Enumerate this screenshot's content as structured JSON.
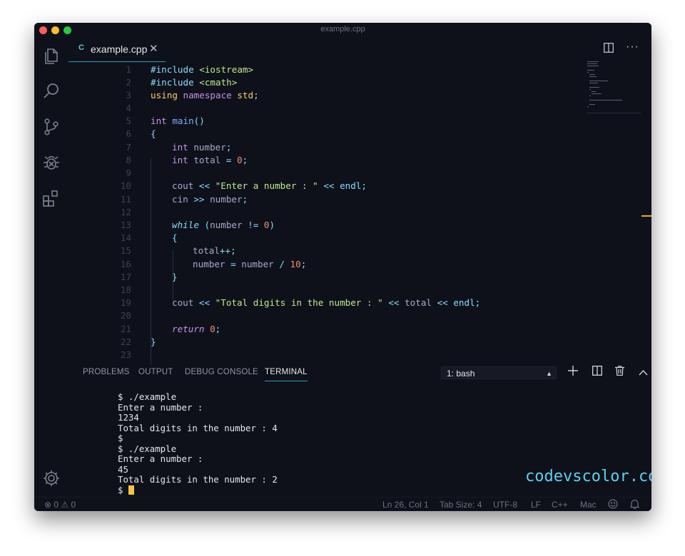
{
  "window": {
    "title": "example.cpp"
  },
  "tab": {
    "icon": "cpp-file-icon",
    "icon_glyph": "C",
    "label": "example.cpp",
    "close": "✕"
  },
  "editor": {
    "lines": [
      {
        "n": "1"
      },
      {
        "n": "2"
      },
      {
        "n": "3"
      },
      {
        "n": "4"
      },
      {
        "n": "5"
      },
      {
        "n": "6"
      },
      {
        "n": "7"
      },
      {
        "n": "8"
      },
      {
        "n": "9"
      },
      {
        "n": "10"
      },
      {
        "n": "11"
      },
      {
        "n": "12"
      },
      {
        "n": "13"
      },
      {
        "n": "14"
      },
      {
        "n": "15"
      },
      {
        "n": "16"
      },
      {
        "n": "17"
      },
      {
        "n": "18"
      },
      {
        "n": "19"
      },
      {
        "n": "20"
      },
      {
        "n": "21"
      },
      {
        "n": "22"
      },
      {
        "n": "23"
      }
    ],
    "code": {
      "l1_a": "#include",
      "l1_b": " <iostream>",
      "l2_a": "#include",
      "l2_b": " <cmath>",
      "l3_a": "using",
      "l3_b": " namespace",
      "l3_c": " std",
      "l3_d": ";",
      "l5_a": "int",
      "l5_b": " main",
      "l5_c": "()",
      "l6": "{",
      "l7_a": "int",
      "l7_b": " number",
      "l7_c": ";",
      "l8_a": "int",
      "l8_b": " total ",
      "l8_c": "=",
      "l8_d": " 0",
      "l8_e": ";",
      "l10_a": "cout ",
      "l10_b": "<<",
      "l10_c": " \"Enter a number : \"",
      "l10_d": " <<",
      "l10_e": " endl",
      "l10_f": ";",
      "l11_a": "cin ",
      "l11_b": ">>",
      "l11_c": " number",
      "l11_d": ";",
      "l13_a": "while",
      "l13_b": " (",
      "l13_c": "number ",
      "l13_d": "!=",
      "l13_e": " 0",
      "l13_f": ")",
      "l14": "{",
      "l15_a": "total",
      "l15_b": "++",
      "l15_c": ";",
      "l16_a": "number ",
      "l16_b": "=",
      "l16_c": " number ",
      "l16_d": "/",
      "l16_e": " 10",
      "l16_f": ";",
      "l17": "}",
      "l19_a": "cout ",
      "l19_b": "<<",
      "l19_c": " \"Total digits in the number : \"",
      "l19_d": " <<",
      "l19_e": " total ",
      "l19_f": "<<",
      "l19_g": " endl",
      "l19_h": ";",
      "l21_a": "return",
      "l21_b": " 0",
      "l21_c": ";",
      "l22": "}"
    }
  },
  "panel": {
    "tabs": [
      "PROBLEMS",
      "OUTPUT",
      "DEBUG CONSOLE",
      "TERMINAL"
    ],
    "active_tab": "TERMINAL",
    "terminal_select": "1: bash",
    "terminal_lines": [
      "$ ./example",
      "Enter a number :",
      "1234",
      "Total digits in the number : 4",
      "$",
      "$ ./example",
      "Enter a number :",
      "45",
      "Total digits in the number : 2",
      "$ "
    ],
    "watermark": "codevscolor.com"
  },
  "statusbar": {
    "errors": "0",
    "warnings": "0",
    "position": "Ln 26, Col 1",
    "tab_size": "Tab Size: 4",
    "encoding": "UTF-8",
    "eol": "LF",
    "language": "C++",
    "platform": "Mac"
  },
  "colors": {
    "background": "#0e111a",
    "accent": "#2c9bb8",
    "keyword": "#89ddff",
    "type": "#c792ea",
    "string": "#c3e88d",
    "number": "#f78c6c",
    "cursor": "#f5c542"
  }
}
